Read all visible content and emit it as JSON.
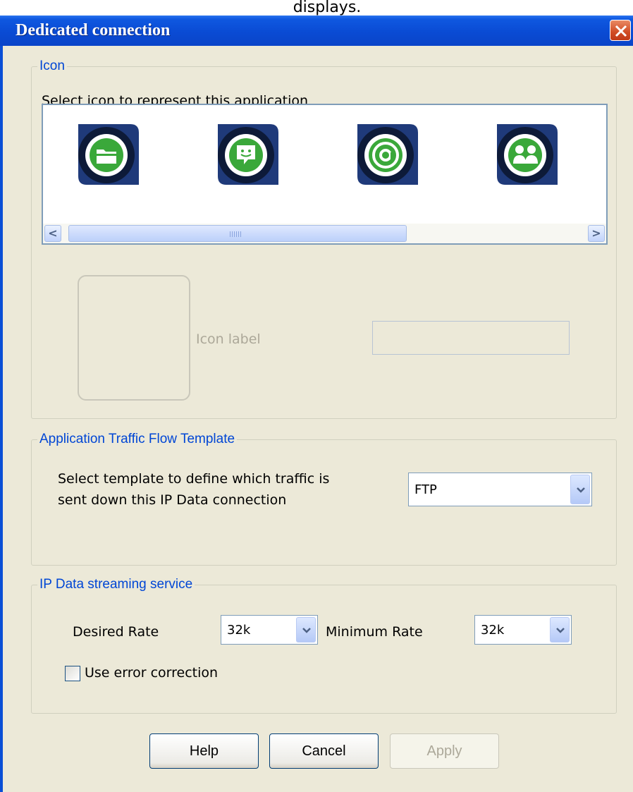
{
  "caption_top": "displays.",
  "window": {
    "title": "Dedicated connection"
  },
  "icon_group": {
    "legend": "Icon",
    "instruction": "Select icon to represent this application",
    "icons": [
      "folder-icon",
      "chat-icon",
      "at-sign-icon",
      "contacts-icon"
    ],
    "icon_label_caption": "Icon label",
    "icon_label_value": "",
    "scrollbar": {
      "left_arrow": "<",
      "right_arrow": ">"
    }
  },
  "traffic_group": {
    "legend": "Application Traffic Flow Template",
    "instruction_line1": "Select template to define which traffic is",
    "instruction_line2": "sent down this IP Data connection",
    "template_value": "FTP"
  },
  "streaming_group": {
    "legend": "IP Data streaming service",
    "desired_rate_label": "Desired Rate",
    "desired_rate_value": "32k",
    "minimum_rate_label": "Minimum Rate",
    "minimum_rate_value": "32k",
    "error_correction_label": "Use error correction",
    "error_correction_checked": false
  },
  "buttons": {
    "help": "Help",
    "cancel": "Cancel",
    "apply": "Apply"
  },
  "colors": {
    "titlebar": "#0a4bd4",
    "legend": "#0046d5",
    "icon_green": "#3aa83a",
    "icon_navy": "#0d1a38"
  }
}
